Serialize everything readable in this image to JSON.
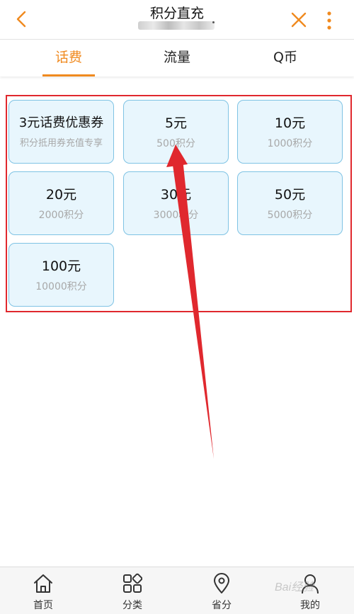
{
  "header": {
    "title": "积分直充",
    "back_icon": "chevron-left-icon",
    "close_icon": "close-icon",
    "more_icon": "more-vertical-icon",
    "accent_color": "#f08a1f"
  },
  "tabs": [
    {
      "label": "话费",
      "active": true
    },
    {
      "label": "流量",
      "active": false
    },
    {
      "label": "Q币",
      "active": false
    }
  ],
  "cards": [
    {
      "main": "3元话费优惠券",
      "sub": "积分抵用券充值专享"
    },
    {
      "main": "5元",
      "sub": "500积分"
    },
    {
      "main": "10元",
      "sub": "1000积分"
    },
    {
      "main": "20元",
      "sub": "2000积分"
    },
    {
      "main": "30元",
      "sub": "3000积分"
    },
    {
      "main": "50元",
      "sub": "5000积分"
    },
    {
      "main": "100元",
      "sub": "10000积分"
    }
  ],
  "bottom_nav": [
    {
      "label": "首页",
      "icon": "home-icon"
    },
    {
      "label": "分类",
      "icon": "category-grid-icon"
    },
    {
      "label": "省分",
      "icon": "location-pin-icon"
    },
    {
      "label": "我的",
      "icon": "user-icon"
    }
  ],
  "annotation": {
    "highlight_color": "#e0282e",
    "arrow_color": "#e0282e"
  },
  "watermark": {
    "text": "Bai经验"
  }
}
